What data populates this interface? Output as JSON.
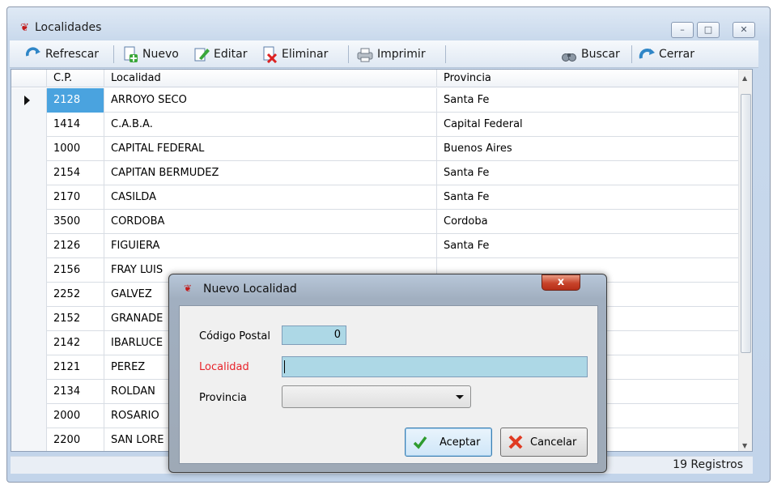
{
  "window": {
    "title": "Localidades",
    "controls": [
      "–",
      "□",
      "✕"
    ]
  },
  "toolbar": {
    "refrescar": "Refrescar",
    "nuevo": "Nuevo",
    "editar": "Editar",
    "eliminar": "Eliminar",
    "imprimir": "Imprimir",
    "buscar": "Buscar",
    "cerrar": "Cerrar"
  },
  "grid": {
    "columns": [
      "C.P.",
      "Localidad",
      "Provincia"
    ],
    "rows": [
      {
        "cp": "2128",
        "localidad": "ARROYO SECO",
        "provincia": "Santa Fe"
      },
      {
        "cp": "1414",
        "localidad": "C.A.B.A.",
        "provincia": "Capital Federal"
      },
      {
        "cp": "1000",
        "localidad": "CAPITAL FEDERAL",
        "provincia": "Buenos Aires"
      },
      {
        "cp": "2154",
        "localidad": "CAPITAN BERMUDEZ",
        "provincia": "Santa Fe"
      },
      {
        "cp": "2170",
        "localidad": "CASILDA",
        "provincia": "Santa Fe"
      },
      {
        "cp": "3500",
        "localidad": "CORDOBA",
        "provincia": "Cordoba"
      },
      {
        "cp": "2126",
        "localidad": "FIGUIERA",
        "provincia": "Santa Fe"
      },
      {
        "cp": "2156",
        "localidad": "FRAY LUIS",
        "provincia": ""
      },
      {
        "cp": "2252",
        "localidad": "GALVEZ",
        "provincia": ""
      },
      {
        "cp": "2152",
        "localidad": "GRANADE",
        "provincia": ""
      },
      {
        "cp": "2142",
        "localidad": "IBARLUCE",
        "provincia": ""
      },
      {
        "cp": "2121",
        "localidad": "PEREZ",
        "provincia": ""
      },
      {
        "cp": "2134",
        "localidad": "ROLDAN",
        "provincia": ""
      },
      {
        "cp": "2000",
        "localidad": "ROSARIO",
        "provincia": ""
      },
      {
        "cp": "2200",
        "localidad": "SAN LORE",
        "provincia": ""
      }
    ]
  },
  "status": {
    "count": "19 Registros"
  },
  "dialog": {
    "title": "Nuevo Localidad",
    "close": "x",
    "codigo_postal_label": "Código Postal",
    "codigo_postal_value": "0",
    "localidad_label": "Localidad",
    "localidad_value": "",
    "provincia_label": "Provincia",
    "provincia_value": "",
    "aceptar": "Aceptar",
    "cancelar": "Cancelar"
  },
  "colors": {
    "selected_row": "#4aa3df",
    "input_bg": "#add8e6",
    "required_label": "#e8232a"
  }
}
